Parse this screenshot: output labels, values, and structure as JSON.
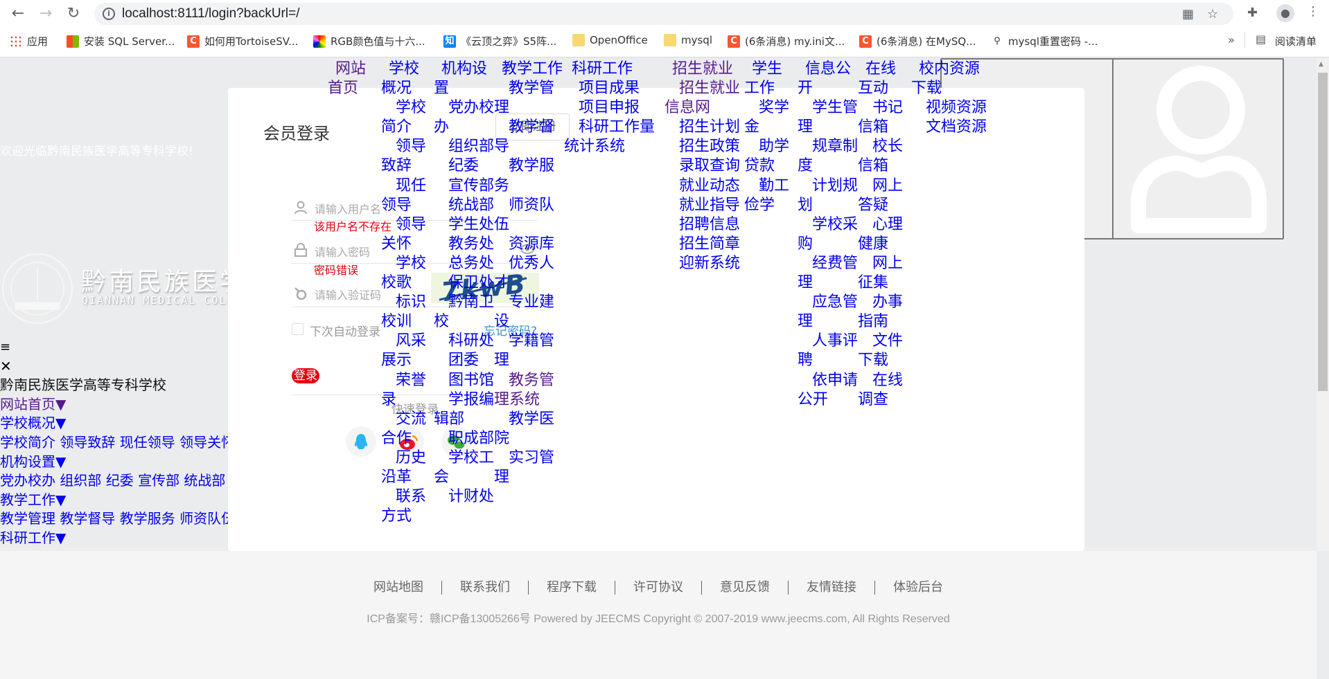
{
  "browser": {
    "url": "localhost:8111/login?backUrl=/",
    "bookmarks": [
      {
        "label": "应用",
        "icon": "apps-grid-icon"
      },
      {
        "label": "安装 SQL Server...",
        "icon": "windows-logo-icon"
      },
      {
        "label": "如何用TortoiseSV...",
        "icon": "csdn-icon"
      },
      {
        "label": "RGB颜色值与十六...",
        "icon": "rainbow-icon"
      },
      {
        "label": "《云顶之弈》S5阵...",
        "icon": "zhihu-icon"
      },
      {
        "label": "OpenOffice",
        "icon": "folder-icon"
      },
      {
        "label": "mysql",
        "icon": "folder-icon"
      },
      {
        "label": "(6条消息) my.ini文...",
        "icon": "csdn-icon"
      },
      {
        "label": "(6条消息) 在MySQ...",
        "icon": "csdn-icon"
      },
      {
        "label": "mysql重置密码 -...",
        "icon": "bookmark-site-icon"
      }
    ],
    "more": "»",
    "reading_list": "阅读清单"
  },
  "nav": [
    {
      "label": "网站首页",
      "visited": true,
      "items": []
    },
    {
      "label": "学校概况",
      "items": [
        {
          "label": "学校简介"
        },
        {
          "label": "领导致辞"
        },
        {
          "label": "现任领导"
        },
        {
          "label": "领导关怀"
        },
        {
          "label": "学校校歌"
        },
        {
          "label": "标识校训"
        },
        {
          "label": "风采展示"
        },
        {
          "label": "荣誉录"
        },
        {
          "label": "交流合作"
        },
        {
          "label": "历史沿革"
        },
        {
          "label": "联系方式"
        }
      ]
    },
    {
      "label": "机构设置",
      "items": [
        {
          "label": "党办校办"
        },
        {
          "label": "组织部"
        },
        {
          "label": "纪委"
        },
        {
          "label": "宣传部"
        },
        {
          "label": "统战部"
        },
        {
          "label": "学生处"
        },
        {
          "label": "教务处"
        },
        {
          "label": "总务处"
        },
        {
          "label": "保卫处"
        },
        {
          "label": "黔南卫校"
        },
        {
          "label": "科研处"
        },
        {
          "label": "团委"
        },
        {
          "label": "图书馆"
        },
        {
          "label": "学报编辑部"
        },
        {
          "label": "职成部"
        },
        {
          "label": "学校工会"
        },
        {
          "label": "计财处"
        }
      ]
    },
    {
      "label": "教学工作",
      "items": [
        {
          "label": "教学管理"
        },
        {
          "label": "教学督导"
        },
        {
          "label": "教学服务"
        },
        {
          "label": "师资队伍"
        },
        {
          "label": "资源库"
        },
        {
          "label": "优秀人才"
        },
        {
          "label": "专业建设"
        },
        {
          "label": "学籍管理"
        },
        {
          "label": "教务管理系统",
          "visited": true
        },
        {
          "label": "教学医院"
        },
        {
          "label": "实习管理"
        }
      ]
    },
    {
      "label": "科研工作",
      "items": [
        {
          "label": "项目成果"
        },
        {
          "label": "项目申报"
        },
        {
          "label": "科研工作量统计系统"
        }
      ]
    },
    {
      "label": "招生就业",
      "visited": true,
      "items": [
        {
          "label": "招生就业信息网",
          "visited": true
        },
        {
          "label": "招生计划"
        },
        {
          "label": "招生政策"
        },
        {
          "label": "录取查询"
        },
        {
          "label": "就业动态"
        },
        {
          "label": "就业指导"
        },
        {
          "label": "招聘信息"
        },
        {
          "label": "招生简章"
        },
        {
          "label": "迎新系统"
        }
      ]
    },
    {
      "label": "学生工作",
      "items": [
        {
          "label": "奖学金"
        },
        {
          "label": "助学贷款"
        },
        {
          "label": "勤工俭学"
        }
      ]
    },
    {
      "label": "信息公开",
      "items": [
        {
          "label": "学生管理"
        },
        {
          "label": "规章制度"
        },
        {
          "label": "计划规划"
        },
        {
          "label": "学校采购"
        },
        {
          "label": "经费管理"
        },
        {
          "label": "应急管理"
        },
        {
          "label": "人事评聘"
        },
        {
          "label": "依申请公开"
        }
      ]
    },
    {
      "label": "在线互动",
      "items": [
        {
          "label": "书记信箱"
        },
        {
          "label": "校长信箱"
        },
        {
          "label": "网上答疑"
        },
        {
          "label": "心理健康"
        },
        {
          "label": "网上征集"
        },
        {
          "label": "办事指南"
        },
        {
          "label": "文件下载"
        },
        {
          "label": "在线调查"
        }
      ]
    },
    {
      "label": "校内资源下载",
      "items": [
        {
          "label": "视频资源"
        },
        {
          "label": "文档资源"
        }
      ]
    }
  ],
  "left": {
    "welcome": "欢迎光临黔南民族医学高等专科学校!",
    "logo_cn": "黔南民族医学",
    "logo_en": "QIANNAN MEDICAL COLLE"
  },
  "mobile_menu": {
    "hamburger": "≡",
    "close": "✕",
    "title": "黔南民族医学高等专科学校",
    "lines": [
      {
        "type": "heading",
        "label": "网站首页▼",
        "visited": true
      },
      {
        "type": "heading",
        "label": "学校概况▼"
      },
      {
        "type": "links",
        "label": "学校简介 领导致辞 现任领导 领导关怀"
      },
      {
        "type": "heading",
        "label": "机构设置▼"
      },
      {
        "type": "links",
        "label": "党办校办 组织部 纪委 宣传部 统战部"
      },
      {
        "type": "heading",
        "label": "教学工作▼"
      },
      {
        "type": "links",
        "label": "教学管理 教学督导 教学服务 师资队伍"
      },
      {
        "type": "heading",
        "label": "科研工作▼"
      }
    ]
  },
  "login": {
    "title": "会员登录",
    "register": "立即注册",
    "username_placeholder": "请输入用户名",
    "username_error": "该用户名不存在",
    "password_placeholder": "请输入密码",
    "password_error": "密码错误",
    "captcha_placeholder": "请输入验证码",
    "captcha_text": "7kwB",
    "remember": "下次自动登录",
    "forgot": "忘记密码?",
    "submit": "登录",
    "quick_login": "快速登录",
    "social": [
      "qq-icon",
      "weibo-icon",
      "wechat-icon"
    ],
    "colors": {
      "button": "#e60012",
      "error": "#e60012",
      "link": "#3a8fc9"
    }
  },
  "footer": {
    "links": [
      "网站地图",
      "联系我们",
      "程序下载",
      "许可协议",
      "意见反馈",
      "友情链接",
      "体验后台"
    ],
    "icp": "ICP备案号：赣ICP备13005266号 Powered by JEECMS Copyright © 2007-2019 www.jeecms.com, All Rights Reserved"
  }
}
